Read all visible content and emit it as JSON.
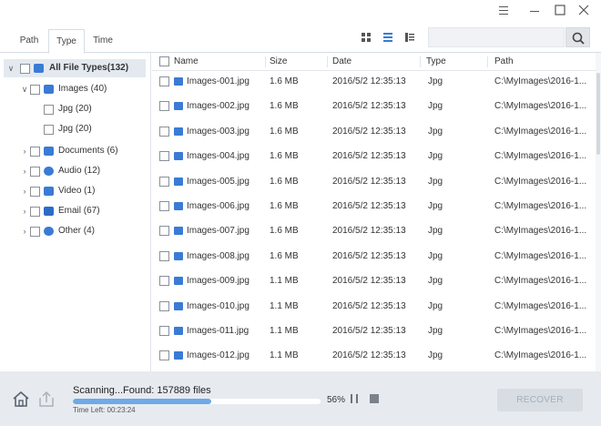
{
  "tabs": [
    {
      "label": "Path"
    },
    {
      "label": "Type"
    },
    {
      "label": "Time"
    }
  ],
  "search": {
    "placeholder": ""
  },
  "tree": {
    "root": "All File Types(132)",
    "images": "Images (40)",
    "jpg1": "Jpg (20)",
    "jpg2": "Jpg (20)",
    "documents": "Documents (6)",
    "audio": "Audio (12)",
    "video": "Video (1)",
    "email": "Email (67)",
    "other": "Other (4)"
  },
  "columns": {
    "name": "Name",
    "size": "Size",
    "date": "Date",
    "type": "Type",
    "path": "Path"
  },
  "files": [
    {
      "name": "Images-001.jpg",
      "size": "1.6 MB",
      "date": "2016/5/2 12:35:13",
      "type": "Jpg",
      "path": "C:\\MyImages\\2016-1..."
    },
    {
      "name": "Images-002.jpg",
      "size": "1.6 MB",
      "date": "2016/5/2 12:35:13",
      "type": "Jpg",
      "path": "C:\\MyImages\\2016-1..."
    },
    {
      "name": "Images-003.jpg",
      "size": "1.6 MB",
      "date": "2016/5/2 12:35:13",
      "type": "Jpg",
      "path": "C:\\MyImages\\2016-1..."
    },
    {
      "name": "Images-004.jpg",
      "size": "1.6 MB",
      "date": "2016/5/2 12:35:13",
      "type": "Jpg",
      "path": "C:\\MyImages\\2016-1..."
    },
    {
      "name": "Images-005.jpg",
      "size": "1.6 MB",
      "date": "2016/5/2 12:35:13",
      "type": "Jpg",
      "path": "C:\\MyImages\\2016-1..."
    },
    {
      "name": "Images-006.jpg",
      "size": "1.6 MB",
      "date": "2016/5/2 12:35:13",
      "type": "Jpg",
      "path": "C:\\MyImages\\2016-1..."
    },
    {
      "name": "Images-007.jpg",
      "size": "1.6 MB",
      "date": "2016/5/2 12:35:13",
      "type": "Jpg",
      "path": "C:\\MyImages\\2016-1..."
    },
    {
      "name": "Images-008.jpg",
      "size": "1.6 MB",
      "date": "2016/5/2 12:35:13",
      "type": "Jpg",
      "path": "C:\\MyImages\\2016-1..."
    },
    {
      "name": "Images-009.jpg",
      "size": "1.1 MB",
      "date": "2016/5/2 12:35:13",
      "type": "Jpg",
      "path": "C:\\MyImages\\2016-1..."
    },
    {
      "name": "Images-010.jpg",
      "size": "1.1 MB",
      "date": "2016/5/2 12:35:13",
      "type": "Jpg",
      "path": "C:\\MyImages\\2016-1..."
    },
    {
      "name": "Images-011.jpg",
      "size": "1.1 MB",
      "date": "2016/5/2 12:35:13",
      "type": "Jpg",
      "path": "C:\\MyImages\\2016-1..."
    },
    {
      "name": "Images-012.jpg",
      "size": "1.1 MB",
      "date": "2016/5/2 12:35:13",
      "type": "Jpg",
      "path": "C:\\MyImages\\2016-1..."
    }
  ],
  "status": {
    "title": "Scanning...Found: 157889 files",
    "progress_percent": 56,
    "percent_label": "56%",
    "time_left": "Time Left: 00:23:24",
    "recover_label": "RECOVER"
  },
  "colors": {
    "accent": "#3a7bd5",
    "progress": "#6fa9e6",
    "status_bg": "#e7ebf0"
  }
}
